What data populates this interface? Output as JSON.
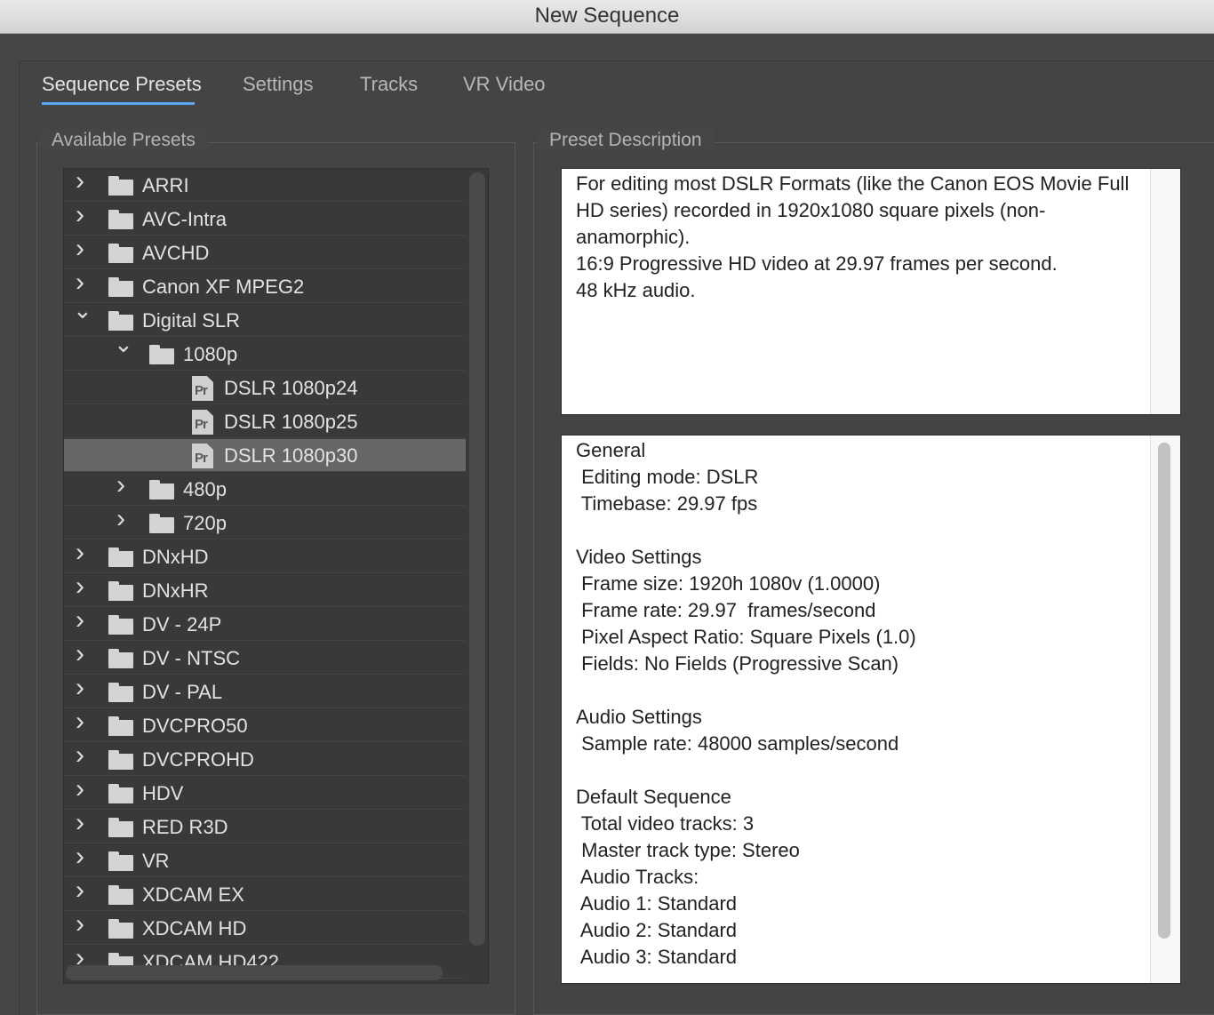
{
  "window": {
    "title": "New Sequence"
  },
  "tabs": [
    {
      "label": "Sequence Presets",
      "active": true
    },
    {
      "label": "Settings",
      "active": false
    },
    {
      "label": "Tracks",
      "active": false
    },
    {
      "label": "VR Video",
      "active": false
    }
  ],
  "presets": {
    "title": "Available Presets",
    "items": [
      {
        "label": "ARRI",
        "type": "folder",
        "level": 0,
        "expanded": false
      },
      {
        "label": "AVC-Intra",
        "type": "folder",
        "level": 0,
        "expanded": false
      },
      {
        "label": "AVCHD",
        "type": "folder",
        "level": 0,
        "expanded": false
      },
      {
        "label": "Canon XF MPEG2",
        "type": "folder",
        "level": 0,
        "expanded": false
      },
      {
        "label": "Digital SLR",
        "type": "folder",
        "level": 0,
        "expanded": true
      },
      {
        "label": "1080p",
        "type": "folder",
        "level": 1,
        "expanded": true
      },
      {
        "label": "DSLR 1080p24",
        "type": "preset",
        "level": 2,
        "icon": "Pr"
      },
      {
        "label": "DSLR 1080p25",
        "type": "preset",
        "level": 2,
        "icon": "Pr"
      },
      {
        "label": "DSLR 1080p30",
        "type": "preset",
        "level": 2,
        "icon": "Pr",
        "selected": true
      },
      {
        "label": "480p",
        "type": "folder",
        "level": 1,
        "expanded": false
      },
      {
        "label": "720p",
        "type": "folder",
        "level": 1,
        "expanded": false
      },
      {
        "label": "DNxHD",
        "type": "folder",
        "level": 0,
        "expanded": false
      },
      {
        "label": "DNxHR",
        "type": "folder",
        "level": 0,
        "expanded": false
      },
      {
        "label": "DV - 24P",
        "type": "folder",
        "level": 0,
        "expanded": false
      },
      {
        "label": "DV - NTSC",
        "type": "folder",
        "level": 0,
        "expanded": false
      },
      {
        "label": "DV - PAL",
        "type": "folder",
        "level": 0,
        "expanded": false
      },
      {
        "label": "DVCPRO50",
        "type": "folder",
        "level": 0,
        "expanded": false
      },
      {
        "label": "DVCPROHD",
        "type": "folder",
        "level": 0,
        "expanded": false
      },
      {
        "label": "HDV",
        "type": "folder",
        "level": 0,
        "expanded": false
      },
      {
        "label": "RED R3D",
        "type": "folder",
        "level": 0,
        "expanded": false
      },
      {
        "label": "VR",
        "type": "folder",
        "level": 0,
        "expanded": false
      },
      {
        "label": "XDCAM EX",
        "type": "folder",
        "level": 0,
        "expanded": false
      },
      {
        "label": "XDCAM HD",
        "type": "folder",
        "level": 0,
        "expanded": false
      },
      {
        "label": "XDCAM HD422",
        "type": "folder",
        "level": 0,
        "expanded": false
      }
    ]
  },
  "description": {
    "title": "Preset Description",
    "text_lines": [
      "For editing most DSLR Formats (like the Canon EOS Movie Full",
      "HD series) recorded in 1920x1080 square pixels (non-",
      "anamorphic).",
      "16:9 Progressive HD video at 29.97 frames per second.",
      "48 kHz audio."
    ],
    "details_lines": [
      "General",
      " Editing mode: DSLR",
      " Timebase: 29.97 fps",
      "",
      "Video Settings",
      " Frame size: 1920h 1080v (1.0000)",
      " Frame rate: 29.97  frames/second",
      " Pixel Aspect Ratio: Square Pixels (1.0)",
      " Fields: No Fields (Progressive Scan)",
      "",
      "Audio Settings",
      " Sample rate: 48000 samples/second",
      "",
      "Default Sequence",
      " Total video tracks: 3",
      " Master track type: Stereo",
      " Audio Tracks:",
      " Audio 1: Standard",
      " Audio 2: Standard",
      " Audio 3: Standard"
    ]
  }
}
